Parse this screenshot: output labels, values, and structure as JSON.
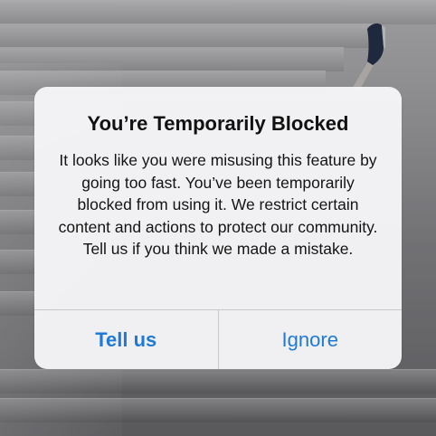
{
  "alert": {
    "title": "You’re Temporarily Blocked",
    "message": "It looks like you were misusing this feature by going too fast. You’ve been temporarily blocked from using it. We restrict certain content and actions to protect our community. Tell us if you think we made a mistake.",
    "buttons": {
      "tell_us": "Tell us",
      "ignore": "Ignore"
    }
  },
  "colors": {
    "button_text": "#1f7ad6",
    "dialog_background": "#f6f6f8"
  },
  "background": {
    "description_icon": "staircase-photo"
  }
}
